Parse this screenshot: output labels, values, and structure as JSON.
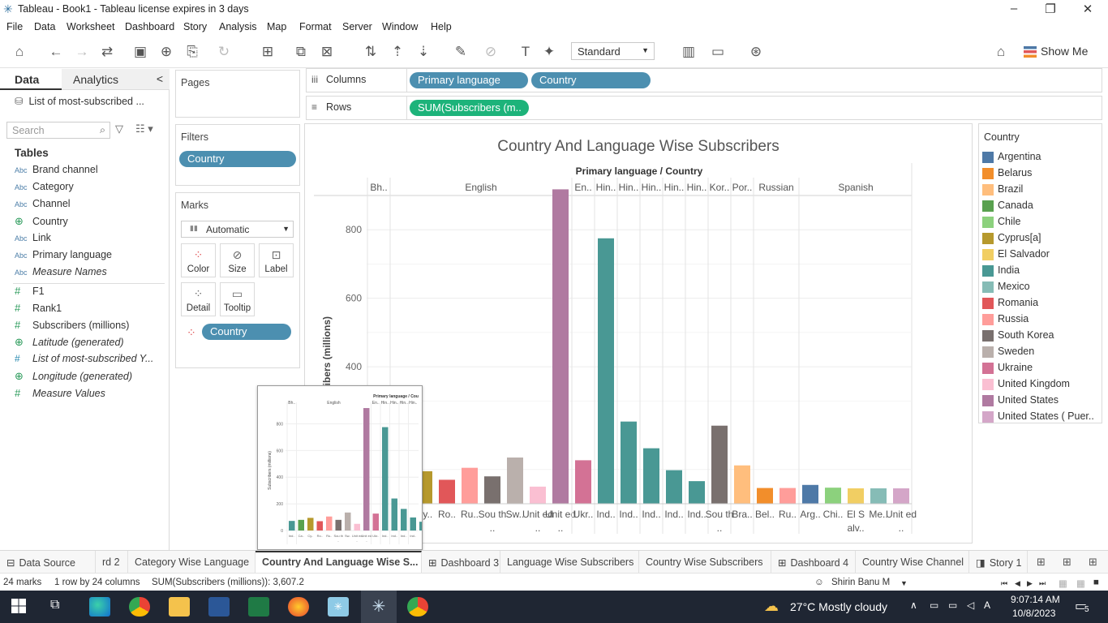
{
  "window": {
    "title": "Tableau - Book1 - Tableau license expires in 3 days",
    "minimize_glyph": "–",
    "restore_glyph": "❐",
    "close_glyph": "✕"
  },
  "menu": [
    "File",
    "Data",
    "Worksheet",
    "Dashboard",
    "Story",
    "Analysis",
    "Map",
    "Format",
    "Server",
    "Window",
    "Help"
  ],
  "toolbar": {
    "fit_select": "Standard",
    "show_me": "Show Me"
  },
  "left_panel": {
    "tab_data": "Data",
    "tab_analytics": "Analytics",
    "collapse_glyph": "<",
    "datasource": "List of most-subscribed ...",
    "search_placeholder": "Search",
    "tables_heading": "Tables",
    "dimensions": [
      {
        "icon": "Abc",
        "name": "Brand channel",
        "italic": false
      },
      {
        "icon": "Abc",
        "name": "Category",
        "italic": false
      },
      {
        "icon": "Abc",
        "name": "Channel",
        "italic": false
      },
      {
        "icon": "globe",
        "name": "Country",
        "italic": false
      },
      {
        "icon": "Abc",
        "name": "Link",
        "italic": false
      },
      {
        "icon": "Abc",
        "name": "Primary language",
        "italic": false
      },
      {
        "icon": "Abc",
        "name": "Measure Names",
        "italic": true
      }
    ],
    "measures": [
      {
        "icon": "#",
        "name": "F1",
        "italic": false
      },
      {
        "icon": "#",
        "name": "Rank1",
        "italic": false
      },
      {
        "icon": "#",
        "name": "Subscribers (millions)",
        "italic": false
      },
      {
        "icon": "globe",
        "name": "Latitude (generated)",
        "italic": true
      },
      {
        "icon": "=#",
        "name": "List of most-subscribed Y...",
        "italic": true
      },
      {
        "icon": "globe",
        "name": "Longitude (generated)",
        "italic": true
      },
      {
        "icon": "#",
        "name": "Measure Values",
        "italic": true
      }
    ]
  },
  "pages": {
    "title": "Pages"
  },
  "filters": {
    "title": "Filters",
    "pill": "Country"
  },
  "marks": {
    "title": "Marks",
    "type": "Automatic",
    "buttons": [
      "Color",
      "Size",
      "Label",
      "Detail",
      "Tooltip"
    ],
    "color_pill": "Country"
  },
  "shelves": {
    "columns_label": "Columns",
    "columns_pills": [
      "Primary language",
      "Country"
    ],
    "rows_label": "Rows",
    "rows_pill": "SUM(Subscribers (m.."
  },
  "chart_data": {
    "type": "bar",
    "title": "Country And Language Wise Subscribers",
    "header": "Primary language / Country",
    "ylabel": "Subscribers (millions)",
    "yticks": [
      400,
      600,
      800
    ],
    "ylim": [
      0,
      900
    ],
    "groups": [
      {
        "language": "Bh..",
        "bars": [
          {
            "country": "India",
            "label": "Ind..",
            "value": 72
          }
        ]
      },
      {
        "language": "English",
        "bars": [
          {
            "country": "Canada",
            "label": "Ca..",
            "value": 80
          },
          {
            "country": "Cyprus[a]",
            "label": "Cy..",
            "value": 95
          },
          {
            "country": "Romania",
            "label": "Ro..",
            "value": 70
          },
          {
            "country": "Russia",
            "label": "Ru..",
            "value": 105
          },
          {
            "country": "South Korea",
            "label": "Sou th ..",
            "value": 80
          },
          {
            "country": "Sweden",
            "label": "Sw..",
            "value": 135
          },
          {
            "country": "United Kingdom",
            "label": "Unit ed ..",
            "value": 50
          },
          {
            "country": "United States",
            "label": "Unit ed ..",
            "value": 918
          }
        ]
      },
      {
        "language": "En..",
        "bars": [
          {
            "country": "Ukraine",
            "label": "Ukr..",
            "value": 127
          }
        ]
      },
      {
        "language": "Hin..",
        "bars": [
          {
            "country": "India",
            "label": "Ind..",
            "value": 775
          }
        ]
      },
      {
        "language": "Hin..",
        "bars": [
          {
            "country": "India",
            "label": "Ind..",
            "value": 240
          }
        ]
      },
      {
        "language": "Hin..",
        "bars": [
          {
            "country": "India",
            "label": "Ind..",
            "value": 162
          }
        ]
      },
      {
        "language": "Hin..",
        "bars": [
          {
            "country": "India",
            "label": "Ind..",
            "value": 98
          }
        ]
      },
      {
        "language": "Hin..",
        "bars": [
          {
            "country": "India",
            "label": "Ind..",
            "value": 66
          }
        ]
      },
      {
        "language": "Kor..",
        "bars": [
          {
            "country": "South Korea",
            "label": "Sou th ..",
            "value": 228
          }
        ]
      },
      {
        "language": "Por..",
        "bars": [
          {
            "country": "Brazil",
            "label": "Bra..",
            "value": 112
          }
        ]
      },
      {
        "language": "Russian",
        "bars": [
          {
            "country": "Belarus",
            "label": "Bel..",
            "value": 46
          },
          {
            "country": "Russia",
            "label": "Ru..",
            "value": 46
          }
        ]
      },
      {
        "language": "Spanish",
        "bars": [
          {
            "country": "Argentina",
            "label": "Arg..",
            "value": 55
          },
          {
            "country": "Chile",
            "label": "Chi..",
            "value": 47
          },
          {
            "country": "El Salvador",
            "label": "El S alv..",
            "value": 45
          },
          {
            "country": "Mexico",
            "label": "Me..",
            "value": 45
          },
          {
            "country": "United States ( Puer..",
            "label": "Unit ed ..",
            "value": 45
          }
        ]
      }
    ]
  },
  "legend": {
    "title": "Country",
    "items": [
      {
        "name": "Argentina",
        "color": "#4e79a7"
      },
      {
        "name": "Belarus",
        "color": "#f28e2b"
      },
      {
        "name": "Brazil",
        "color": "#ffbe7d"
      },
      {
        "name": "Canada",
        "color": "#59a14f"
      },
      {
        "name": "Chile",
        "color": "#8cd17d"
      },
      {
        "name": "Cyprus[a]",
        "color": "#b6992d"
      },
      {
        "name": "El Salvador",
        "color": "#f1ce63"
      },
      {
        "name": "India",
        "color": "#499894"
      },
      {
        "name": "Mexico",
        "color": "#86bcb6"
      },
      {
        "name": "Romania",
        "color": "#e15759"
      },
      {
        "name": "Russia",
        "color": "#ff9d9a"
      },
      {
        "name": "South Korea",
        "color": "#79706e"
      },
      {
        "name": "Sweden",
        "color": "#bab0ac"
      },
      {
        "name": "Ukraine",
        "color": "#d37295"
      },
      {
        "name": "United Kingdom",
        "color": "#fabfd2"
      },
      {
        "name": "United States",
        "color": "#b07aa1"
      },
      {
        "name": "United States ( Puer..",
        "color": "#d4a6c8"
      }
    ]
  },
  "sheet_tabs": [
    {
      "label": "Data Source",
      "active": false,
      "icon": "⊟"
    },
    {
      "label": "rd 2",
      "active": false,
      "icon": ""
    },
    {
      "label": "Category Wise Language",
      "active": false,
      "icon": ""
    },
    {
      "label": "Country And Language Wise S...",
      "active": true,
      "icon": ""
    },
    {
      "label": "Dashboard 3",
      "active": false,
      "icon": "⊞"
    },
    {
      "label": "Language Wise Subscribers",
      "active": false,
      "icon": ""
    },
    {
      "label": "Country Wise Subscribers",
      "active": false,
      "icon": ""
    },
    {
      "label": "Dashboard 4",
      "active": false,
      "icon": "⊞"
    },
    {
      "label": "Country Wise Channel",
      "active": false,
      "icon": ""
    },
    {
      "label": "Story 1",
      "active": false,
      "icon": "◨"
    }
  ],
  "status": {
    "marks": "24 marks",
    "rows": "1 row by 24 columns",
    "sum": "SUM(Subscribers (millions)): 3,607.2",
    "user": "Shirin Banu M"
  },
  "taskbar": {
    "weather": "27°C  Mostly cloudy",
    "time": "9:07:14 AM",
    "date": "10/8/2023",
    "notifications": "5"
  },
  "thumb": {
    "header": "Primary language / Cou",
    "ylabel": "Subscribers (millions)",
    "ticks": [
      "800",
      "600",
      "400",
      "200",
      "0"
    ],
    "langs": [
      "Bh..",
      "English",
      "En..",
      "Hin..",
      "Hin..",
      "Hin..",
      "Hin.."
    ],
    "xlabels": [
      "Ind..",
      "Ca..",
      "Cy..",
      "Ro..",
      "Ru..",
      "Sou th ..",
      "Sw..",
      "Unit ed ..",
      "Unit ed ..",
      "Ukr..",
      "Ind..",
      "Ind..",
      "Ind..",
      "Ind.."
    ]
  }
}
